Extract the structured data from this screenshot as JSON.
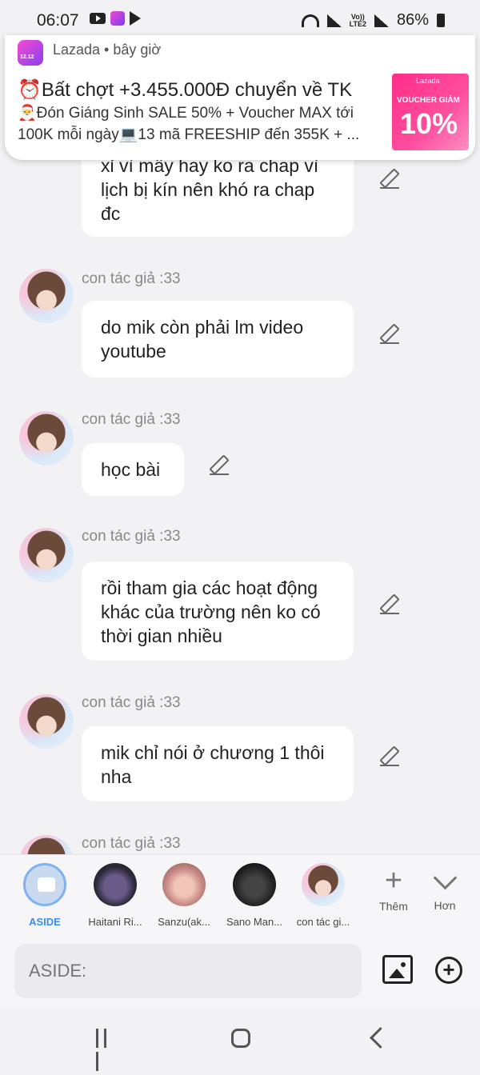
{
  "status_bar": {
    "time": "06:07",
    "network": "LTE2",
    "volte": "Vo))",
    "battery": "86%"
  },
  "notification": {
    "app": "Lazada • bây giờ",
    "title": "⏰Bất chợt +3.455.000Đ chuyển về TK",
    "body": "🎅Đón Giáng Sinh SALE 50% + Voucher MAX tới 100K mỗi ngày💻13 mã FREESHIP đến 355K + ...",
    "image_brand": "Lazada",
    "image_voucher": "VOUCHER GIẢM",
    "image_percent": "10%"
  },
  "messages": [
    {
      "name": "",
      "text": "xỉ vì mấy hay ko ra chap vì lịch bị kín nên khó ra chap đc"
    },
    {
      "name": "con tác giả :33",
      "text": "do mik còn phải lm video youtube"
    },
    {
      "name": "con tác giả :33",
      "text": "học bài"
    },
    {
      "name": "con tác giả :33",
      "text": "rồi tham gia các hoạt động khác của trường nên ko có thời gian nhiều"
    },
    {
      "name": "con tác giả :33",
      "text": "mik chỉ nói ở chương 1 thôi nha"
    },
    {
      "name": "con tác giả :33",
      "text": ""
    }
  ],
  "characters": [
    {
      "label": "ASIDE"
    },
    {
      "label": "Haitani Ri..."
    },
    {
      "label": "Sanzu(ak..."
    },
    {
      "label": "Sano Man..."
    },
    {
      "label": "con tác gi..."
    }
  ],
  "tools": {
    "more_label": "Thêm",
    "expand_label": "Hơn"
  },
  "input": {
    "placeholder": "ASIDE:"
  },
  "colors": {
    "accent": "#3b8ee8",
    "background": "#f2f2f4",
    "bubble": "#ffffff",
    "promo": "#ff2d87"
  }
}
